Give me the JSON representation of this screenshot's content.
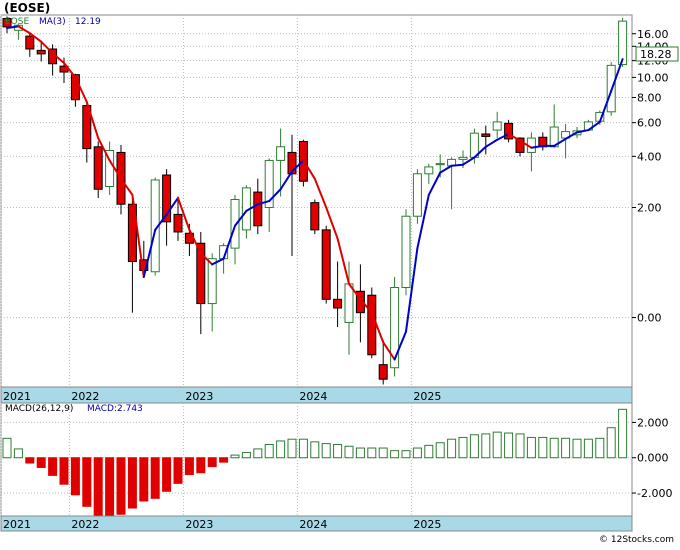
{
  "header": {
    "title": "(EOSE)"
  },
  "price_panel": {
    "legend_symbol": "EOSE",
    "legend_ma": "MA(3)",
    "legend_ma_value": "12.19",
    "last_price_label": "18.28"
  },
  "macd_panel": {
    "legend_label": "MACD(26,12,9)",
    "legend_value": "MACD:2.743"
  },
  "footer": {
    "copyright": "© 12Stocks.com"
  },
  "colors": {
    "up": "#2e7d32",
    "down": "#e00000",
    "ma_rising": "#0000cc",
    "ma_falling": "#e00000",
    "axis_band": "#a9d8e6",
    "legend_text": "#0000aa"
  },
  "chart_data": [
    {
      "type": "candlestick",
      "x_axis": {
        "labels": [
          "2021",
          "2022",
          "2023",
          "2024",
          "2025"
        ],
        "label_positions": [
          0,
          6,
          16,
          26,
          36
        ]
      },
      "y_axis": {
        "scale": "symlog",
        "tick_labels": [
          "0.00",
          "2.00",
          "4.00",
          "6.00",
          "8.00",
          "10.00",
          "12.00",
          "14.00",
          "16.00"
        ],
        "tick_values": [
          0,
          2,
          4,
          6,
          8,
          10,
          12,
          14,
          16
        ],
        "range": [
          -1,
          19.5
        ]
      },
      "grid": true,
      "series": [
        {
          "name": "EOSE",
          "candles": [
            {
              "o": 18.8,
              "h": 19.2,
              "l": 16.1,
              "c": 17.2
            },
            {
              "o": 16.6,
              "h": 17.8,
              "l": 15.0,
              "c": 17.5
            },
            {
              "o": 15.6,
              "h": 16.0,
              "l": 12.5,
              "c": 13.6
            },
            {
              "o": 13.4,
              "h": 14.6,
              "l": 11.9,
              "c": 12.9
            },
            {
              "o": 13.6,
              "h": 14.3,
              "l": 10.2,
              "c": 11.6
            },
            {
              "o": 11.3,
              "h": 12.4,
              "l": 9.4,
              "c": 10.6
            },
            {
              "o": 10.3,
              "h": 10.4,
              "l": 7.2,
              "c": 7.8
            },
            {
              "o": 7.3,
              "h": 7.6,
              "l": 3.7,
              "c": 4.4
            },
            {
              "o": 4.5,
              "h": 4.8,
              "l": 2.3,
              "c": 2.6
            },
            {
              "o": 2.7,
              "h": 4.8,
              "l": 2.4,
              "c": 4.3
            },
            {
              "o": 4.2,
              "h": 4.6,
              "l": 1.8,
              "c": 2.1
            },
            {
              "o": 2.1,
              "h": 2.3,
              "l": 0.05,
              "c": 0.75
            },
            {
              "o": 0.78,
              "h": 1.15,
              "l": 0.55,
              "c": 0.6
            },
            {
              "o": 0.58,
              "h": 3.05,
              "l": 0.52,
              "c": 2.95
            },
            {
              "o": 3.15,
              "h": 3.4,
              "l": 1.05,
              "c": 1.6
            },
            {
              "o": 1.8,
              "h": 2.35,
              "l": 1.15,
              "c": 1.35
            },
            {
              "o": 1.32,
              "h": 1.55,
              "l": 0.85,
              "c": 1.1
            },
            {
              "o": 1.1,
              "h": 1.35,
              "l": -0.18,
              "c": 0.15
            },
            {
              "o": 0.15,
              "h": 0.9,
              "l": -0.15,
              "c": 0.8
            },
            {
              "o": 0.8,
              "h": 1.1,
              "l": 0.55,
              "c": 1.05
            },
            {
              "o": 1.0,
              "h": 2.4,
              "l": 0.7,
              "c": 2.25
            },
            {
              "o": 1.4,
              "h": 2.75,
              "l": 1.2,
              "c": 2.65
            },
            {
              "o": 2.5,
              "h": 3.0,
              "l": 1.3,
              "c": 1.5
            },
            {
              "o": 2.0,
              "h": 3.9,
              "l": 1.35,
              "c": 3.8
            },
            {
              "o": 3.8,
              "h": 5.6,
              "l": 2.35,
              "c": 4.5
            },
            {
              "o": 4.2,
              "h": 5.2,
              "l": 0.85,
              "c": 3.2
            },
            {
              "o": 4.8,
              "h": 4.9,
              "l": 2.7,
              "c": 2.9
            },
            {
              "o": 2.15,
              "h": 2.25,
              "l": 1.3,
              "c": 1.4
            },
            {
              "o": 1.4,
              "h": 1.5,
              "l": 0.15,
              "c": 0.2
            },
            {
              "o": 0.2,
              "h": 0.75,
              "l": -0.1,
              "c": 0.1
            },
            {
              "o": -0.05,
              "h": 0.75,
              "l": -0.45,
              "c": 0.4
            },
            {
              "o": 0.3,
              "h": 0.7,
              "l": -0.28,
              "c": 0.05
            },
            {
              "o": 0.25,
              "h": 0.35,
              "l": -0.5,
              "c": -0.45
            },
            {
              "o": -0.6,
              "h": -0.25,
              "l": -0.95,
              "c": -0.85
            },
            {
              "o": -0.65,
              "h": 0.5,
              "l": -0.8,
              "c": 0.35
            },
            {
              "o": 0.35,
              "h": 1.95,
              "l": 0.25,
              "c": 1.75
            },
            {
              "o": 1.75,
              "h": 3.4,
              "l": 1.55,
              "c": 3.2
            },
            {
              "o": 3.2,
              "h": 3.65,
              "l": 2.8,
              "c": 3.5
            },
            {
              "o": 3.6,
              "h": 4.1,
              "l": 3.05,
              "c": 3.65
            },
            {
              "o": 3.55,
              "h": 3.95,
              "l": 1.95,
              "c": 3.85
            },
            {
              "o": 3.85,
              "h": 4.3,
              "l": 3.45,
              "c": 3.95
            },
            {
              "o": 3.95,
              "h": 5.6,
              "l": 3.65,
              "c": 5.3
            },
            {
              "o": 5.25,
              "h": 5.8,
              "l": 4.1,
              "c": 5.1
            },
            {
              "o": 5.5,
              "h": 6.8,
              "l": 5.0,
              "c": 6.05
            },
            {
              "o": 5.95,
              "h": 6.2,
              "l": 4.75,
              "c": 4.95
            },
            {
              "o": 5.0,
              "h": 5.05,
              "l": 4.0,
              "c": 4.2
            },
            {
              "o": 4.2,
              "h": 5.35,
              "l": 3.3,
              "c": 5.0
            },
            {
              "o": 5.05,
              "h": 5.35,
              "l": 4.3,
              "c": 4.5
            },
            {
              "o": 4.5,
              "h": 7.4,
              "l": 4.45,
              "c": 5.7
            },
            {
              "o": 5.0,
              "h": 5.9,
              "l": 3.9,
              "c": 5.4
            },
            {
              "o": 5.2,
              "h": 5.7,
              "l": 5.0,
              "c": 5.45
            },
            {
              "o": 5.5,
              "h": 6.2,
              "l": 5.45,
              "c": 6.05
            },
            {
              "o": 6.1,
              "h": 6.9,
              "l": 5.85,
              "c": 6.75
            },
            {
              "o": 6.8,
              "h": 11.8,
              "l": 6.5,
              "c": 11.4
            },
            {
              "o": 11.5,
              "h": 18.9,
              "l": 11.2,
              "c": 18.28
            }
          ]
        }
      ],
      "overlays": [
        {
          "name": "MA(3)",
          "values": [
            17.0,
            17.3,
            16.1,
            14.7,
            13.0,
            11.7,
            10.0,
            7.6,
            5.0,
            3.8,
            3.0,
            2.4,
            0.5,
            1.4,
            1.8,
            2.3,
            1.4,
            0.9,
            0.7,
            0.8,
            1.5,
            1.9,
            2.1,
            2.2,
            2.6,
            3.3,
            3.8,
            3.0,
            2.0,
            1.2,
            0.4,
            0.2,
            0.05,
            -0.28,
            -0.52,
            -0.15,
            1.0,
            2.4,
            3.25,
            3.55,
            3.6,
            3.95,
            4.5,
            4.9,
            5.25,
            4.85,
            4.45,
            4.55,
            4.55,
            4.95,
            5.35,
            5.5,
            6.05,
            8.6,
            12.19
          ]
        }
      ]
    },
    {
      "type": "bar",
      "title": "MACD(26,12,9)",
      "y_axis": {
        "tick_labels": [
          "2.000",
          "0.000",
          "-2.000"
        ],
        "tick_values": [
          2,
          0,
          -2
        ],
        "range": [
          -3.3,
          3.1
        ]
      },
      "grid": true,
      "series": [
        {
          "name": "MACD",
          "values": [
            1.1,
            0.5,
            -0.3,
            -0.55,
            -1.0,
            -1.5,
            -2.1,
            -2.75,
            -3.25,
            -3.25,
            -3.2,
            -2.85,
            -2.45,
            -2.3,
            -1.9,
            -1.45,
            -0.95,
            -0.85,
            -0.5,
            -0.25,
            0.15,
            0.3,
            0.5,
            0.75,
            0.95,
            1.05,
            1.05,
            0.9,
            0.8,
            0.75,
            0.65,
            0.55,
            0.55,
            0.55,
            0.4,
            0.4,
            0.55,
            0.7,
            0.85,
            1.05,
            1.15,
            1.3,
            1.35,
            1.45,
            1.4,
            1.35,
            1.15,
            1.15,
            1.1,
            1.1,
            1.05,
            1.05,
            1.1,
            1.7,
            2.743
          ]
        }
      ]
    }
  ]
}
